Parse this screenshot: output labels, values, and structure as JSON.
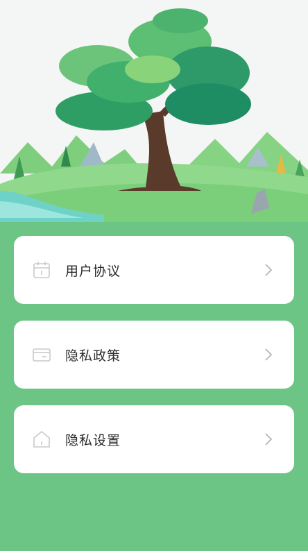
{
  "theme": {
    "background": "#6cc585",
    "card": "#ffffff",
    "icon_stroke": "#c9c9c9"
  },
  "hero": {
    "image": "tree-on-green-hills-illustration"
  },
  "menu": [
    {
      "icon": "calendar-icon",
      "label": "用户协议"
    },
    {
      "icon": "card-icon",
      "label": "隐私政策"
    },
    {
      "icon": "home-icon",
      "label": "隐私设置"
    }
  ]
}
